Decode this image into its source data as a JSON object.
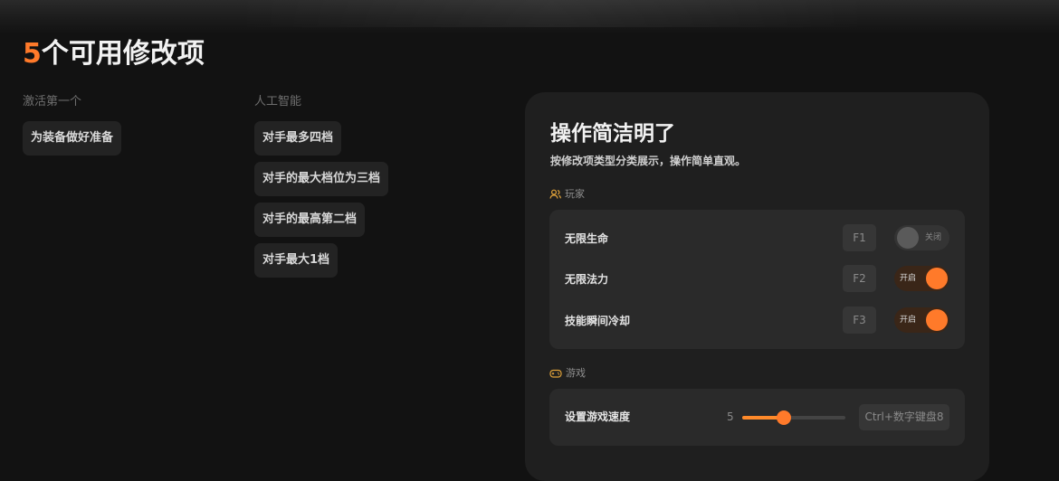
{
  "header": {
    "count": "5",
    "title_rest": "个可用修改项"
  },
  "columns": [
    {
      "label": "激活第一个",
      "items": [
        "为装备做好准备"
      ]
    },
    {
      "label": "人工智能",
      "items": [
        "对手最多四档",
        "对手的最大档位为三档",
        "对手的最高第二档",
        "对手最大1档"
      ]
    }
  ],
  "panel": {
    "title": "操作简洁明了",
    "subtitle": "按修改项类型分类展示，操作简单直观。",
    "player_section": {
      "label": "玩家",
      "icon": "users-icon",
      "rows": [
        {
          "label": "无限生命",
          "key": "F1",
          "state": "off",
          "state_label": "关闭"
        },
        {
          "label": "无限法力",
          "key": "F2",
          "state": "on",
          "state_label": "开启"
        },
        {
          "label": "技能瞬间冷却",
          "key": "F3",
          "state": "on",
          "state_label": "开启"
        }
      ]
    },
    "game_section": {
      "label": "游戏",
      "icon": "gamepad-icon",
      "slider": {
        "label": "设置游戏速度",
        "value": "5",
        "fraction": 0.4,
        "hotkey": "Ctrl+数字键盘8"
      }
    }
  },
  "colors": {
    "accent": "#ff7a2a",
    "background": "#121212",
    "panel": "#1f1f1f",
    "group": "#2a2a2a"
  }
}
